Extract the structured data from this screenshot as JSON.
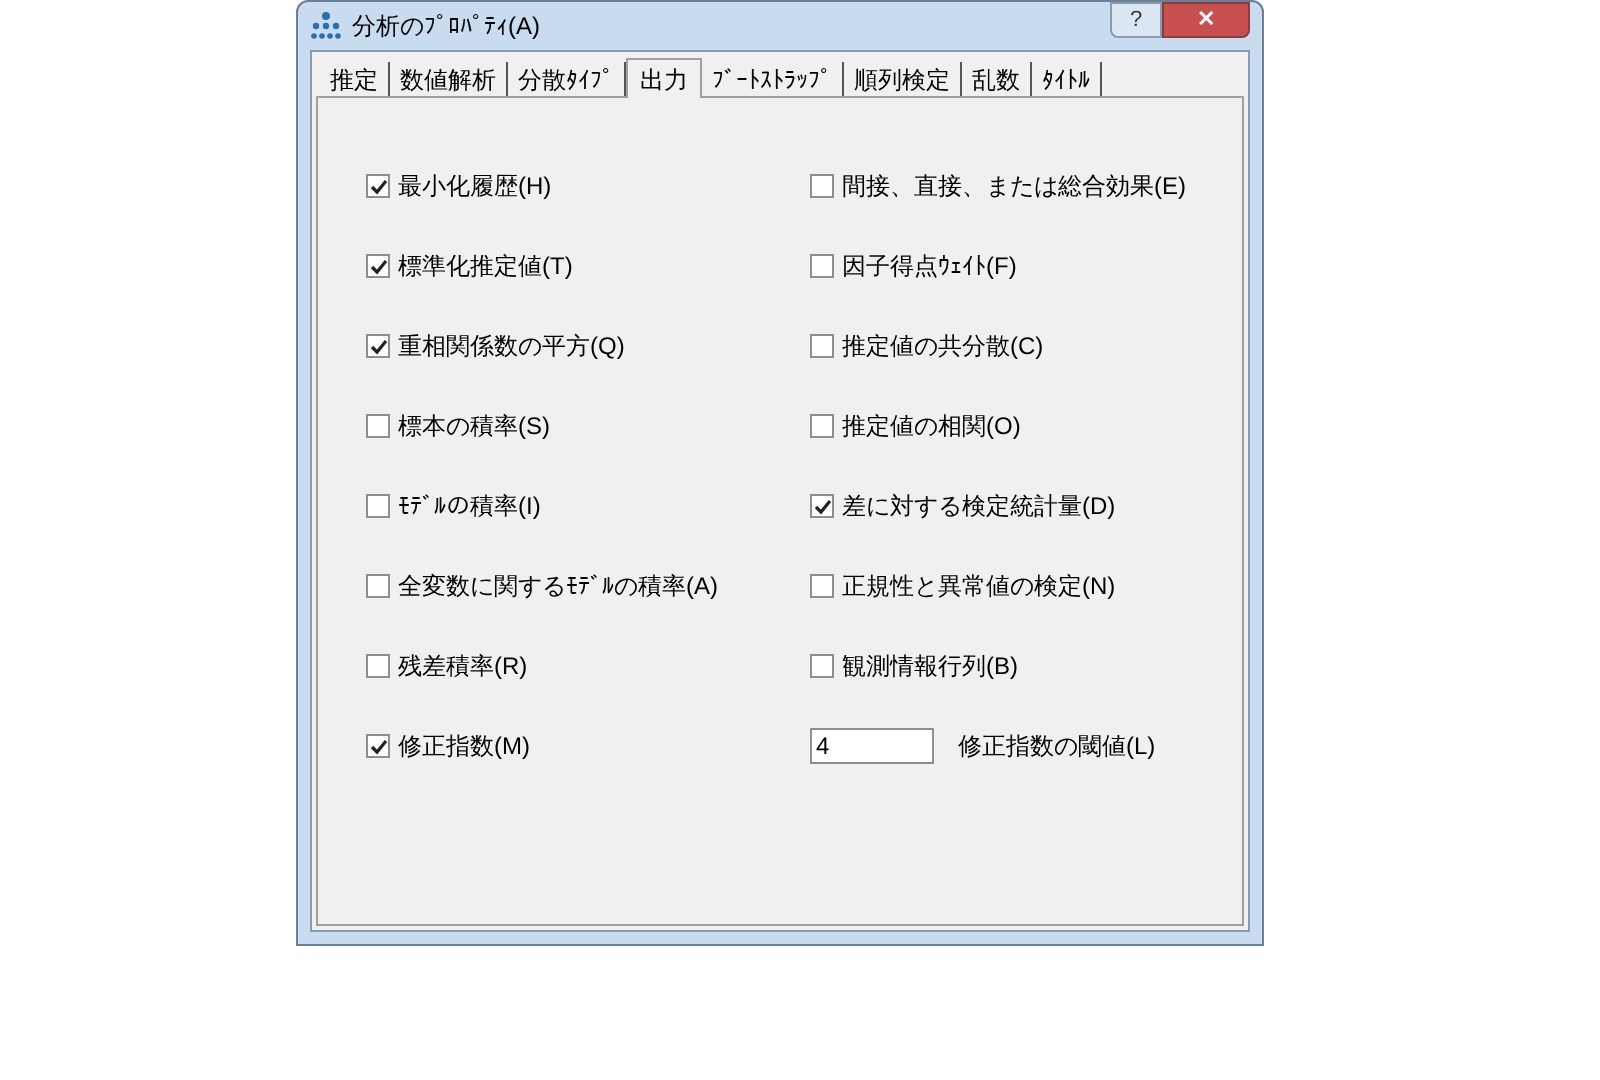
{
  "window": {
    "title": "分析のﾌﾟﾛﾊﾟﾃｨ(A)",
    "help_button": "?",
    "close_button": "✕"
  },
  "tabs": [
    {
      "label": "推定",
      "selected": false
    },
    {
      "label": "数値解析",
      "selected": false
    },
    {
      "label": "分散ﾀｲﾌﾟ",
      "selected": false
    },
    {
      "label": "出力",
      "selected": true
    },
    {
      "label": "ﾌﾞｰﾄｽﾄﾗｯﾌﾟ",
      "selected": false
    },
    {
      "label": "順列検定",
      "selected": false
    },
    {
      "label": "乱数",
      "selected": false
    },
    {
      "label": "ﾀｲﾄﾙ",
      "selected": false
    }
  ],
  "left_options": [
    {
      "label": "最小化履歴(H)",
      "checked": true
    },
    {
      "label": "標準化推定値(T)",
      "checked": true
    },
    {
      "label": "重相関係数の平方(Q)",
      "checked": true
    },
    {
      "label": "標本の積率(S)",
      "checked": false
    },
    {
      "label": "ﾓﾃﾞﾙの積率(I)",
      "checked": false
    },
    {
      "label": "全変数に関するﾓﾃﾞﾙの積率(A)",
      "checked": false
    },
    {
      "label": "残差積率(R)",
      "checked": false
    },
    {
      "label": "修正指数(M)",
      "checked": true
    }
  ],
  "right_options": [
    {
      "label": "間接、直接、または総合効果(E)",
      "checked": false
    },
    {
      "label": "因子得点ｳｪｲﾄ(F)",
      "checked": false
    },
    {
      "label": "推定値の共分散(C)",
      "checked": false
    },
    {
      "label": "推定値の相関(O)",
      "checked": false
    },
    {
      "label": "差に対する検定統計量(D)",
      "checked": true
    },
    {
      "label": "正規性と異常値の検定(N)",
      "checked": false
    },
    {
      "label": "観測情報行列(B)",
      "checked": false
    }
  ],
  "threshold": {
    "value": "4",
    "label": "修正指数の閾値(L)"
  }
}
